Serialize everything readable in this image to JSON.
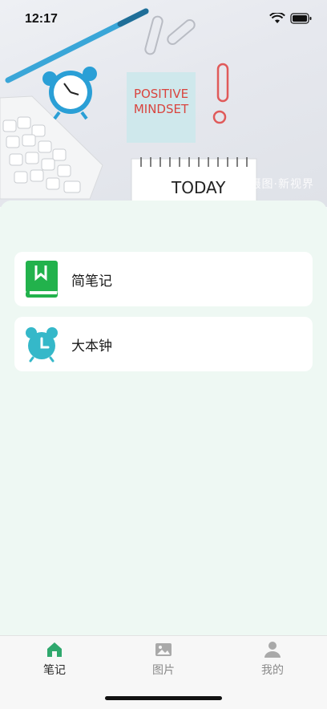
{
  "status_bar": {
    "time": "12:17"
  },
  "hero": {
    "note_line1": "POSITIVE",
    "note_line2": "MINDSET",
    "notepad_text": "TODAY",
    "watermark": "摄图·新视界"
  },
  "cards": [
    {
      "label": "简笔记",
      "icon": "green-bookmark-book-icon"
    },
    {
      "label": "大本钟",
      "icon": "teal-alarm-clock-icon"
    }
  ],
  "tabs": [
    {
      "label": "笔记",
      "icon": "home-icon",
      "active": true
    },
    {
      "label": "图片",
      "icon": "image-icon",
      "active": false
    },
    {
      "label": "我的",
      "icon": "user-icon",
      "active": false
    }
  ],
  "colors": {
    "accent": "#2fa86d",
    "clock": "#35b8c9",
    "book": "#22b24c"
  }
}
